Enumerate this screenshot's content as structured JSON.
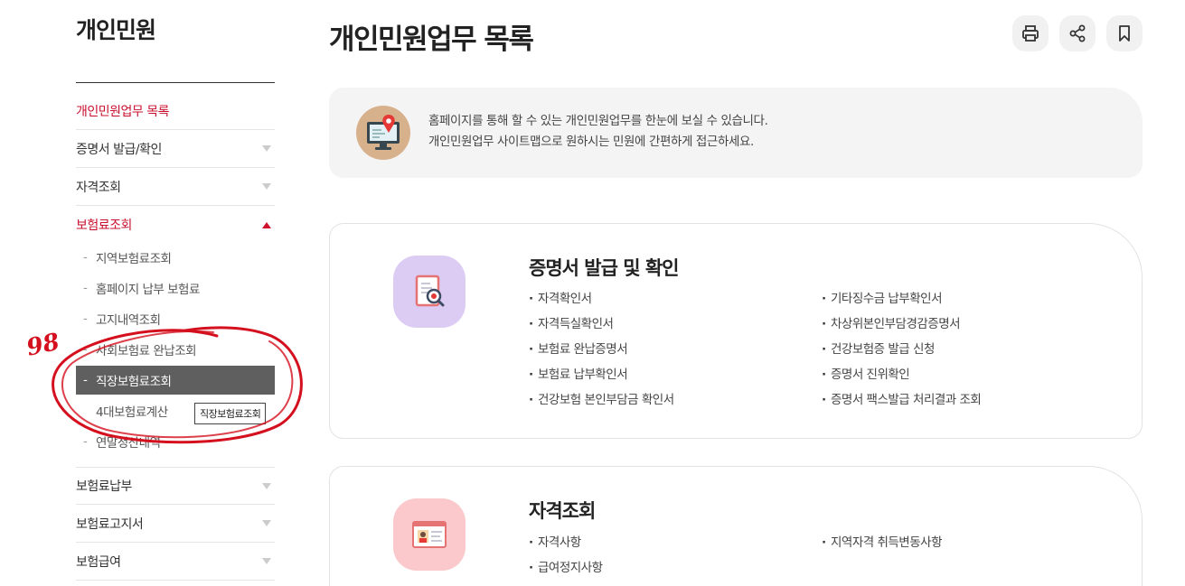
{
  "sidebar": {
    "title": "개인민원",
    "menu": [
      {
        "label": "개인민원업무 목록",
        "state": "active",
        "caret": "none"
      },
      {
        "label": "증명서 발급/확인",
        "state": "normal",
        "caret": "down"
      },
      {
        "label": "자격조회",
        "state": "normal",
        "caret": "down"
      },
      {
        "label": "보험료조회",
        "state": "active",
        "caret": "up"
      },
      {
        "label": "보험료납부",
        "state": "normal",
        "caret": "down"
      },
      {
        "label": "보험료고지서",
        "state": "normal",
        "caret": "down"
      },
      {
        "label": "보험급여",
        "state": "normal",
        "caret": "down"
      }
    ],
    "submenu": [
      {
        "label": "지역보험료조회"
      },
      {
        "label": "홈페이지 납부 보험료"
      },
      {
        "label": "고지내역조회"
      },
      {
        "label": "사회보험료 완납조회"
      },
      {
        "label": "직장보험료조회",
        "selected": true
      },
      {
        "label": "4대보험료계산"
      },
      {
        "label": "연말정산내역"
      }
    ],
    "tooltip": "직장보험료조회",
    "annotation_text": "98"
  },
  "main": {
    "page_title": "개인민원업무 목록",
    "tools": [
      {
        "name": "print-icon"
      },
      {
        "name": "share-icon"
      },
      {
        "name": "bookmark-icon"
      }
    ],
    "intro": {
      "line1": "홈페이지를 통해 할 수 있는 개인민원업무를 한눈에 보실 수 있습니다.",
      "line2": "개인민원업무 사이트맵으로 원하시는 민원에 간편하게 접근하세요."
    },
    "cards": [
      {
        "title": "증명서 발급 및 확인",
        "icon": "certificate-search-icon",
        "icon_bg": "#dcccf4",
        "left": [
          "자격확인서",
          "자격득실확인서",
          "보험료 완납증명서",
          "보험료 납부확인서",
          "건강보험 본인부담금 확인서"
        ],
        "right": [
          "기타징수금 납부확인서",
          "차상위본인부담경감증명서",
          "건강보험증 발급 신청",
          "증명서 진위확인",
          "증명서 팩스발급 처리결과 조회"
        ]
      },
      {
        "title": "자격조회",
        "icon": "id-card-icon",
        "icon_bg": "#fbc9cc",
        "left": [
          "자격사항",
          "급여정지사항"
        ],
        "right": [
          "지역자격 취득변동사항"
        ]
      }
    ]
  },
  "colors": {
    "accent": "#c8102e",
    "selected_bg": "#5f5f5f",
    "annotation": "#d4101e"
  }
}
